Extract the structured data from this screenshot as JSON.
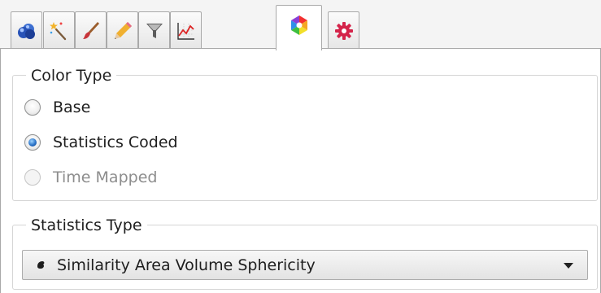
{
  "tabs": [
    {
      "icon": "spheres-icon",
      "active": false
    },
    {
      "icon": "magic-wand-icon",
      "active": false
    },
    {
      "icon": "brush-icon",
      "active": false
    },
    {
      "icon": "pencil-icon",
      "active": false
    },
    {
      "icon": "filter-icon",
      "active": false
    },
    {
      "icon": "graph-icon",
      "active": false
    },
    {
      "icon": "color-wheel-icon",
      "active": true
    },
    {
      "icon": "gear-icon",
      "active": false
    }
  ],
  "color_type": {
    "title": "Color Type",
    "options": [
      {
        "label": "Base",
        "checked": false,
        "enabled": true
      },
      {
        "label": "Statistics Coded",
        "checked": true,
        "enabled": true
      },
      {
        "label": "Time Mapped",
        "checked": false,
        "enabled": false
      }
    ]
  },
  "statistics_type": {
    "title": "Statistics Type",
    "selected": "Similarity Area Volume Sphericity"
  },
  "colors": {
    "radio_checked": "#2a73c8",
    "disabled_text": "#8d8d8d",
    "border": "#a9a9a9"
  }
}
